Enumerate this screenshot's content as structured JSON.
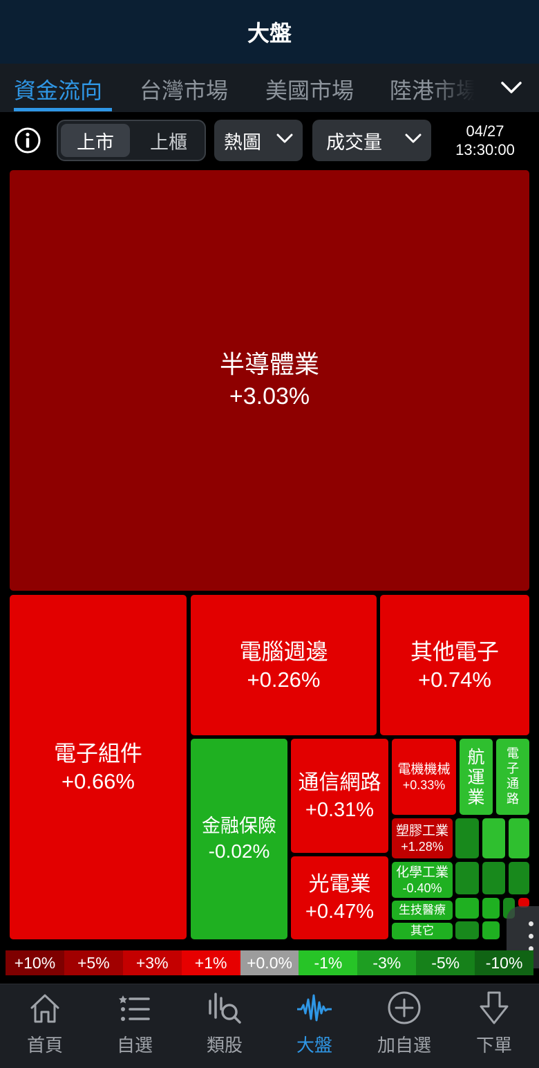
{
  "header": {
    "title": "大盤"
  },
  "tabs": [
    {
      "label": "資金流向",
      "active": true
    },
    {
      "label": "台灣市場",
      "active": false
    },
    {
      "label": "美國市場",
      "active": false
    },
    {
      "label": "陸港市場",
      "active": false
    }
  ],
  "toolbar": {
    "market_segment": {
      "options": [
        "上市",
        "上櫃"
      ],
      "selected": "上市"
    },
    "view_select": "熱圖",
    "metric_select": "成交量",
    "date": "04/27",
    "time": "13:30:00"
  },
  "treemap": {
    "sectors": [
      {
        "name": "半導體業",
        "change": "+3.03%"
      },
      {
        "name": "電子組件",
        "change": "+0.66%"
      },
      {
        "name": "電腦週邊",
        "change": "+0.26%"
      },
      {
        "name": "其他電子",
        "change": "+0.74%"
      },
      {
        "name": "金融保險",
        "change": "-0.02%"
      },
      {
        "name": "通信網路",
        "change": "+0.31%"
      },
      {
        "name": "光電業",
        "change": "+0.47%"
      },
      {
        "name": "電機機械",
        "change": "+0.33%"
      },
      {
        "name": "航運業",
        "change": ""
      },
      {
        "name": "電子通路",
        "change": ""
      },
      {
        "name": "塑膠工業",
        "change": "+1.28%"
      },
      {
        "name": "化學工業",
        "change": "-0.40%"
      },
      {
        "name": "生技醫療",
        "change": ""
      },
      {
        "name": "其它",
        "change": ""
      }
    ]
  },
  "legend": [
    {
      "label": "+10%",
      "color": "#7e0000"
    },
    {
      "label": "+5%",
      "color": "#a10000"
    },
    {
      "label": "+3%",
      "color": "#c40000"
    },
    {
      "label": "+1%",
      "color": "#e60000"
    },
    {
      "label": "+0.0%",
      "color": "#9c9c9c"
    },
    {
      "label": "-1%",
      "color": "#27c427"
    },
    {
      "label": "-3%",
      "color": "#1e9e22"
    },
    {
      "label": "-5%",
      "color": "#16811a"
    },
    {
      "label": "-10%",
      "color": "#106414"
    }
  ],
  "bottom_nav": [
    {
      "label": "首頁",
      "icon": "home-icon",
      "active": false
    },
    {
      "label": "自選",
      "icon": "watchlist-icon",
      "active": false
    },
    {
      "label": "類股",
      "icon": "sector-search-icon",
      "active": false
    },
    {
      "label": "大盤",
      "icon": "pulse-icon",
      "active": true
    },
    {
      "label": "加自選",
      "icon": "plus-circle-icon",
      "active": false
    },
    {
      "label": "下單",
      "icon": "order-arrow-icon",
      "active": false
    }
  ],
  "colors": {
    "accent": "#2f97e6",
    "up": "#e20000",
    "down": "#1fb021",
    "header_bg": "#0b1f33"
  }
}
